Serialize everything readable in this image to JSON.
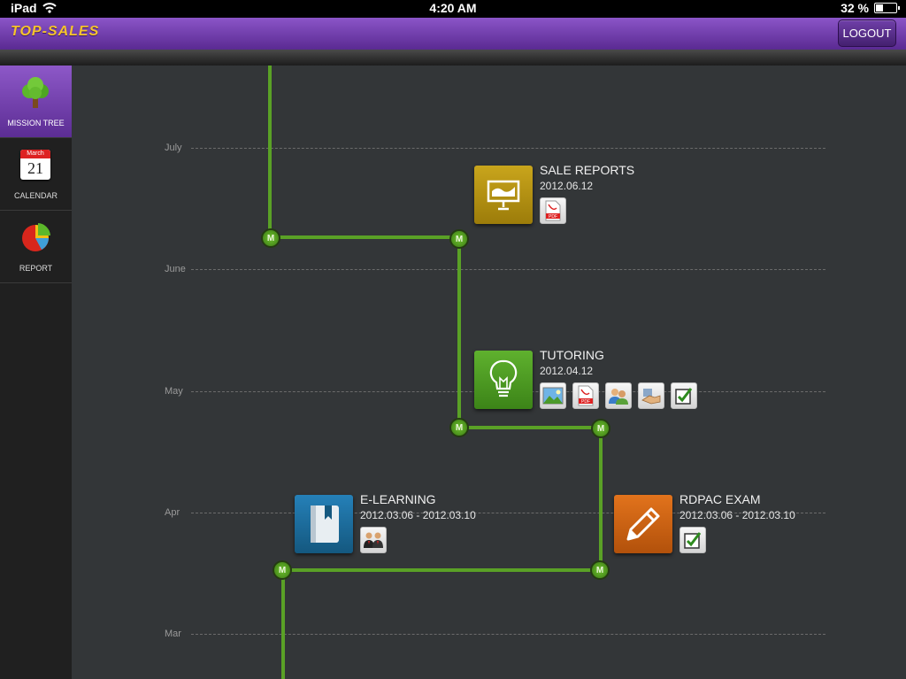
{
  "statusbar": {
    "device": "iPad",
    "time": "4:20 AM",
    "battery": "32 %",
    "battery_level": 0.32
  },
  "header": {
    "title": "TOP-SALES",
    "logout_label": "LOGOUT"
  },
  "sidebar": {
    "items": [
      {
        "label": "MISSION TREE",
        "icon": "tree-icon",
        "active": true
      },
      {
        "label": "CALENDAR",
        "icon": "calendar-icon",
        "calendar_month": "March",
        "calendar_day": "21"
      },
      {
        "label": "REPORT",
        "icon": "pie-chart-icon"
      }
    ]
  },
  "timeline": {
    "months": [
      "July",
      "June",
      "May",
      "Apr",
      "Mar"
    ],
    "milestone_label": "M",
    "missions": [
      {
        "title": "SALE REPORTS",
        "date": "2012.06.12",
        "icon": "presentation-board-icon",
        "color": "#b8940f",
        "attachments": [
          "pdf-icon"
        ]
      },
      {
        "title": "TUTORING",
        "date": "2012.04.12",
        "icon": "lightbulb-icon",
        "color": "#4f9a22",
        "attachments": [
          "image-icon",
          "pdf-icon",
          "users-icon",
          "handshake-icon",
          "checkbox-icon"
        ]
      },
      {
        "title": "E-LEARNING",
        "date": "2012.03.06 - 2012.03.10",
        "icon": "book-icon",
        "color": "#1c6c9e",
        "attachments": [
          "meeting-icon"
        ]
      },
      {
        "title": "RDPAC EXAM",
        "date": "2012.03.06 - 2012.03.10",
        "icon": "pencil-icon",
        "color": "#cf6212",
        "attachments": [
          "checkbox-icon"
        ]
      }
    ]
  },
  "pdf_text": "PDF"
}
